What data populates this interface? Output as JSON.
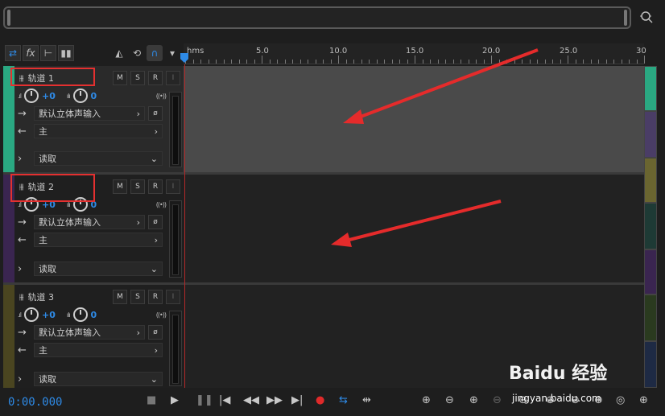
{
  "ruler": {
    "labels": [
      "hms",
      "5.0",
      "10.0",
      "15.0",
      "20.0",
      "25.0",
      "30"
    ]
  },
  "tracks": [
    {
      "name": "轨道 1",
      "volume": "+0",
      "pan": "0",
      "input": "默认立体声输入",
      "output": "主",
      "automation": "读取",
      "color": "#2aa882",
      "mute": "M",
      "solo": "S",
      "record": "R",
      "monitor": "I"
    },
    {
      "name": "轨道 2",
      "volume": "+0",
      "pan": "0",
      "input": "默认立体声输入",
      "output": "主",
      "automation": "读取",
      "color": "#3a2550",
      "mute": "M",
      "solo": "S",
      "record": "R",
      "monitor": "I"
    },
    {
      "name": "轨道 3",
      "volume": "+0",
      "pan": "0",
      "input": "默认立体声输入",
      "output": "主",
      "automation": "读取",
      "color": "#4a4520",
      "mute": "M",
      "solo": "S",
      "record": "R",
      "monitor": "I"
    }
  ],
  "transport": {
    "time": "0:00.000"
  },
  "minimap_colors": [
    "#2aa882",
    "#4a3d66",
    "#6a6530",
    "#1e3a35",
    "#3a2550",
    "#2a3a1f",
    "#1e2a44"
  ],
  "watermark": {
    "logo": "Baidu 经验",
    "url": "jingyan.baidu.com"
  }
}
